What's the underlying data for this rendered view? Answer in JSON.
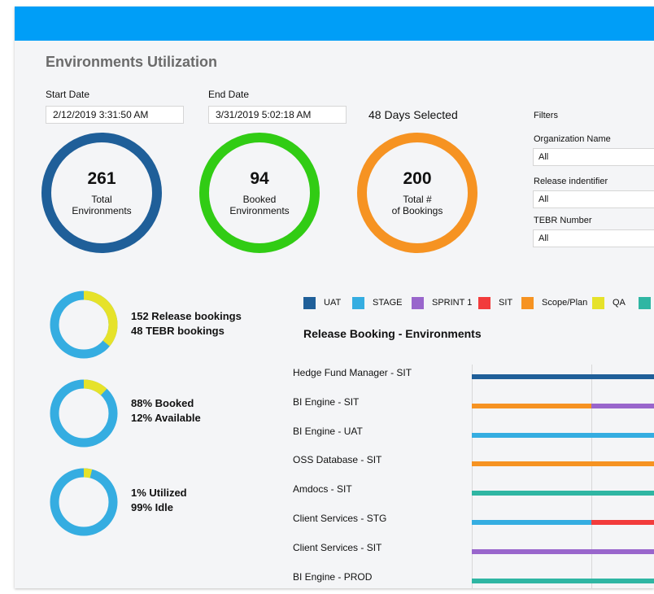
{
  "colors": {
    "topbar": "#009ef7",
    "total": "#1f5f99",
    "booked": "#31cc14",
    "bookings": "#f69322",
    "donut_main": "#35ade1",
    "donut_accent": "#e6e22a"
  },
  "page": {
    "title": "Environments Utilization"
  },
  "dates": {
    "start_label": "Start Date",
    "start_value": "2/12/2019 3:31:50 AM",
    "end_label": "End Date",
    "end_value": "3/31/2019 5:02:18 AM",
    "days_selected": "48 Days Selected"
  },
  "filters": {
    "heading": "Filters",
    "org_label": "Organization Name",
    "org_value": "All",
    "release_label": "Release indentifier",
    "release_value": "All",
    "tebr_label": "TEBR Number",
    "tebr_value": "All"
  },
  "kpis": [
    {
      "value": "261",
      "line1": "Total",
      "line2": "Environments"
    },
    {
      "value": "94",
      "line1": "Booked",
      "line2": "Environments"
    },
    {
      "value": "200",
      "line1": "Total #",
      "line2": "of Bookings"
    }
  ],
  "donuts": [
    {
      "line1": "152 Release bookings",
      "line2": "48 TEBR bookings",
      "accent_fraction": 0.36
    },
    {
      "line1": "88% Booked",
      "line2": "12% Available",
      "accent_fraction": 0.12
    },
    {
      "line1": "1% Utilized",
      "line2": "99% Idle",
      "accent_fraction": 0.04
    }
  ],
  "legend": [
    {
      "label": "UAT",
      "color": "#1f5f99"
    },
    {
      "label": "STAGE",
      "color": "#35ade1"
    },
    {
      "label": "SPRINT 1",
      "color": "#9966cc"
    },
    {
      "label": "SIT",
      "color": "#f23c3c"
    },
    {
      "label": "Scope/Plan",
      "color": "#f69322"
    },
    {
      "label": "QA",
      "color": "#e6e22a"
    },
    {
      "label": "",
      "color": "#2fb6a3"
    }
  ],
  "chart_data": {
    "type": "gantt",
    "title": "Release Booking - Environments",
    "rows": [
      {
        "label": "Hedge Fund Manager - SIT",
        "segments": [
          {
            "category": "UAT",
            "color": "#1f5f99"
          }
        ]
      },
      {
        "label": "BI Engine - SIT",
        "segments": [
          {
            "category": "Scope/Plan",
            "color": "#f69322"
          },
          {
            "category": "SPRINT 1",
            "color": "#9966cc"
          }
        ]
      },
      {
        "label": "BI Engine - UAT",
        "segments": [
          {
            "category": "STAGE",
            "color": "#35ade1"
          }
        ]
      },
      {
        "label": "OSS Database - SIT",
        "segments": [
          {
            "category": "Scope/Plan",
            "color": "#f69322"
          }
        ]
      },
      {
        "label": "Amdocs - SIT",
        "segments": [
          {
            "category": "",
            "color": "#2fb6a3"
          }
        ]
      },
      {
        "label": "Client Services - STG",
        "segments": [
          {
            "category": "STAGE",
            "color": "#35ade1"
          },
          {
            "category": "SIT",
            "color": "#f23c3c"
          }
        ]
      },
      {
        "label": "Client Services - SIT",
        "segments": [
          {
            "category": "SPRINT 1",
            "color": "#9966cc"
          }
        ]
      },
      {
        "label": "BI Engine - PROD",
        "segments": [
          {
            "category": "",
            "color": "#2fb6a3"
          }
        ]
      }
    ]
  }
}
